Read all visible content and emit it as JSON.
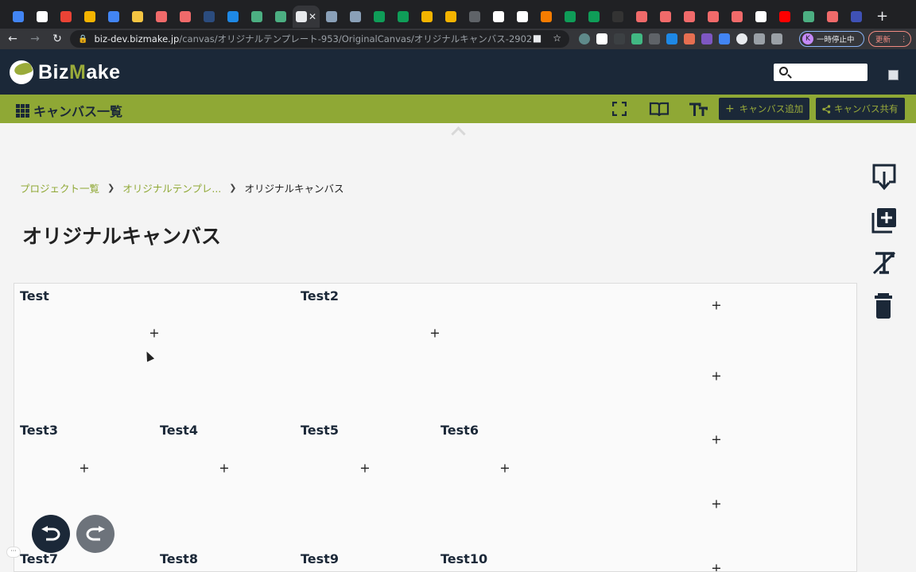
{
  "browser": {
    "url_host": "biz-dev.bizmake.jp",
    "url_path": "/canvas/オリジナルテンプレート-953/OriginalCanvas/オリジナルキャンバス-2902",
    "profile_initial": "K",
    "profile_label": "一時停止中",
    "update_label": "更新",
    "tab_colors": [
      "#4285f4",
      "#ffffff",
      "#ea4335",
      "#f4b400",
      "#4285f4",
      "#f4c542",
      "#f06a6a",
      "#f06a6a",
      "#2b4c7e",
      "#1e88e5",
      "#4caf82",
      "#4caf82",
      "#e8eaed",
      "#8aa0b8",
      "#8aa0b8",
      "#0f9d58",
      "#0f9d58",
      "#f4b400",
      "#f4b400",
      "#5f6368",
      "#ffffff",
      "#ffffff",
      "#f57c00",
      "#0f9d58",
      "#0f9d58",
      "#333333",
      "#f06a6a",
      "#f06a6a",
      "#f06a6a",
      "#f06a6a",
      "#f06a6a",
      "#ffffff",
      "#ff0000",
      "#4caf82",
      "#f06a6a",
      "#3f51b5"
    ]
  },
  "header": {
    "logo_text_a": "Biz",
    "logo_text_m": "M",
    "logo_text_b": "ake"
  },
  "toolbar": {
    "title": "キャンバス一覧",
    "add_canvas": "キャンバス追加",
    "share_canvas": "キャンバス共有"
  },
  "breadcrumb": {
    "items": [
      "プロジェクト一覧",
      "オリジナルテンプレ..."
    ],
    "current": "オリジナルキャンバス"
  },
  "page": {
    "title": "オリジナルキャンバス"
  },
  "canvas": {
    "plus": "+",
    "cells": [
      {
        "title": "Test"
      },
      {
        "title": "Test2"
      },
      {
        "title": ""
      },
      {
        "title": ""
      },
      {
        "title": "Test3"
      },
      {
        "title": "Test4"
      },
      {
        "title": "Test5"
      },
      {
        "title": "Test6"
      },
      {
        "title": ""
      },
      {
        "title": ""
      },
      {
        "title": "Test7"
      },
      {
        "title": "Test8"
      },
      {
        "title": "Test9"
      },
      {
        "title": "Test10"
      },
      {
        "title": ""
      }
    ]
  },
  "colors": {
    "navy": "#1b2838",
    "accent": "#8fa835"
  }
}
